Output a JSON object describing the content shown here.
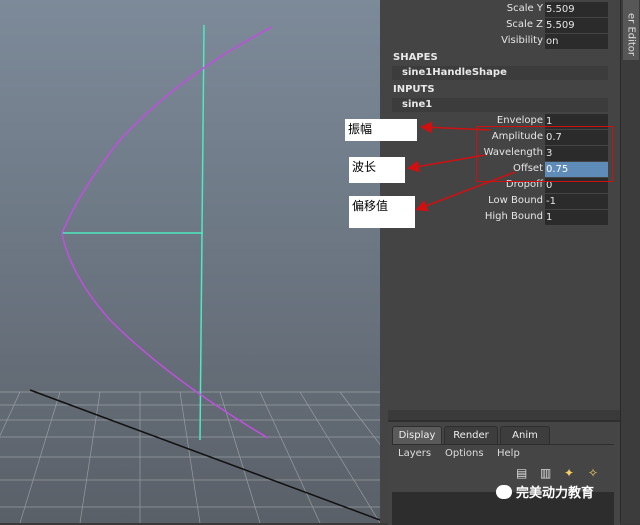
{
  "vertical_tab": {
    "label": "er Editor"
  },
  "attributes_top": [
    {
      "label": "Scale Y",
      "value": "5.509"
    },
    {
      "label": "Scale Z",
      "value": "5.509"
    },
    {
      "label": "Visibility",
      "value": "on"
    }
  ],
  "shapes": {
    "header": "SHAPES",
    "node": "sine1HandleShape"
  },
  "inputs": {
    "header": "INPUTS",
    "node": "sine1"
  },
  "sine_attrs": [
    {
      "label": "Envelope",
      "value": "1"
    },
    {
      "label": "Amplitude",
      "value": "0.7"
    },
    {
      "label": "Wavelength",
      "value": "3"
    },
    {
      "label": "Offset",
      "value": "0.75",
      "selected": true
    },
    {
      "label": "Dropoff",
      "value": "0"
    },
    {
      "label": "Low Bound",
      "value": "-1"
    },
    {
      "label": "High Bound",
      "value": "1"
    }
  ],
  "annotations": {
    "amplitude": "振幅",
    "wavelength": "波长",
    "offset": "偏移值"
  },
  "layer_editor": {
    "tabs": [
      "Display",
      "Render",
      "Anim"
    ],
    "menus": [
      "Layers",
      "Options",
      "Help"
    ]
  },
  "watermark": "完美动力教育",
  "colors": {
    "curve": "#c04fe0",
    "handle": "#4fe8c0",
    "annotation_red": "#d01010",
    "selected_field": "#5e8bb8"
  }
}
